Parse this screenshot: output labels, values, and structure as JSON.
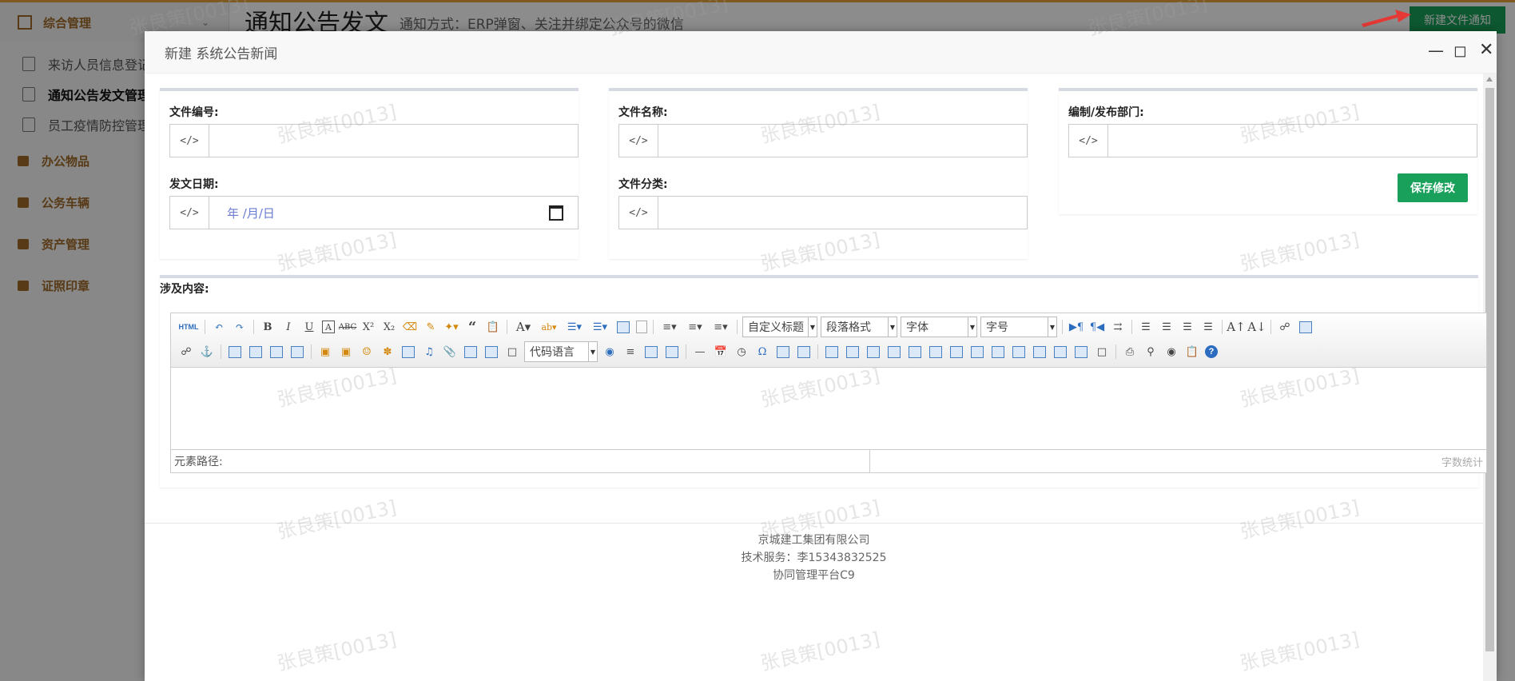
{
  "app": {
    "page_title": "通知公告发文",
    "page_subtitle": "通知方式：ERP弹窗、关注并绑定公众号的微信",
    "new_button": "新建文件通知"
  },
  "sidebar": {
    "top_group": "综合管理",
    "sub_items": [
      "来访人员信息登记",
      "通知公告发文管理",
      "员工疫情防控管理"
    ],
    "groups": [
      "办公物品",
      "公务车辆",
      "资产管理",
      "证照印章"
    ]
  },
  "modal": {
    "title": "新建 系统公告新闻",
    "form": {
      "doc_no_label": "文件编号:",
      "doc_name_label": "文件名称:",
      "dept_label": "编制/发布部门:",
      "date_label": "发文日期:",
      "date_placeholder": "年 /月/日",
      "category_label": "文件分类:",
      "save_button": "保存修改",
      "content_label": "涉及内容:",
      "addon_symbol": "</>"
    },
    "editor": {
      "html_btn": "HTML",
      "combo_heading": "自定义标题",
      "combo_paragraph": "段落格式",
      "combo_font": "字体",
      "combo_size": "字号",
      "combo_code": "代码语言",
      "element_path": "元素路径:",
      "word_count": "字数统计"
    },
    "footer": {
      "company": "京城建工集团有限公司",
      "support": "技术服务：李15343832525",
      "platform": "协同管理平台C9"
    }
  },
  "watermark": "张良策[0013]",
  "colors": {
    "accent_green": "#19a05a",
    "sidebar_gold": "#a06a28",
    "top_border": "#e6a23c"
  }
}
